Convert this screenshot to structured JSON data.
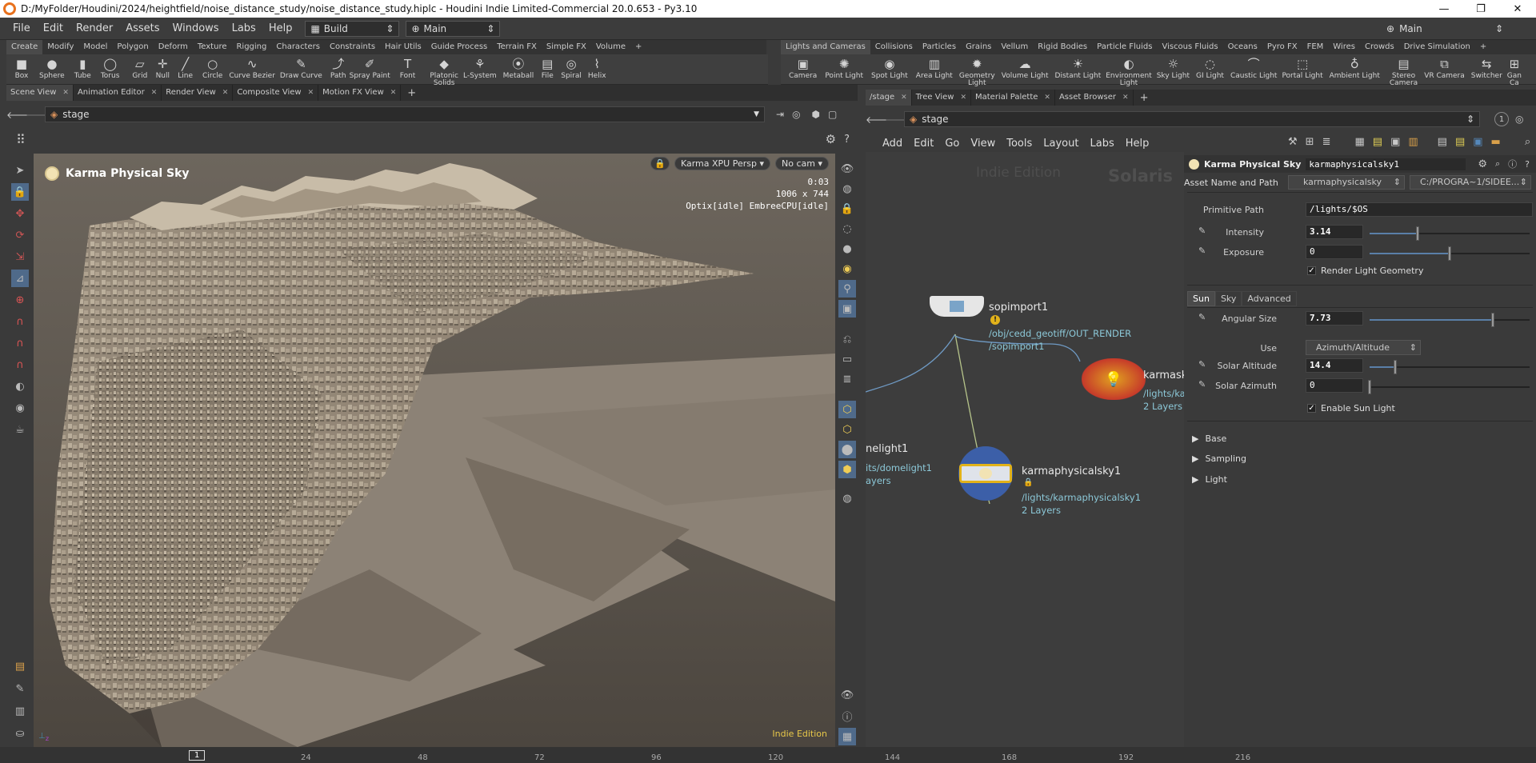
{
  "window": {
    "title": "D:/MyFolder/Houdini/2024/heightfield/noise_distance_study/noise_distance_study.hiplc - Houdini Indie Limited-Commercial 20.0.653 - Py3.10",
    "controls": [
      "—",
      "❐",
      "✕"
    ]
  },
  "menubar": {
    "items": [
      "File",
      "Edit",
      "Render",
      "Assets",
      "Windows",
      "Labs",
      "Help"
    ],
    "desktop": "Build",
    "network": "Main",
    "right_desktop": "Main"
  },
  "shelf_left": {
    "tabs": [
      "Create",
      "Modify",
      "Model",
      "Polygon",
      "Deform",
      "Texture",
      "Rigging",
      "Characters",
      "Constraints",
      "Hair Utils",
      "Guide Process",
      "Terrain FX",
      "Simple FX",
      "Volume",
      "+"
    ],
    "tools": [
      {
        "label": "Box",
        "icon": "box-icon",
        "glyph": "■"
      },
      {
        "label": "Sphere",
        "icon": "sphere-icon",
        "glyph": "●"
      },
      {
        "label": "Tube",
        "icon": "tube-icon",
        "glyph": "▮"
      },
      {
        "label": "Torus",
        "icon": "torus-icon",
        "glyph": "◯"
      },
      {
        "label": "Grid",
        "icon": "grid-icon",
        "glyph": "▱"
      },
      {
        "label": "Null",
        "icon": "null-icon",
        "glyph": "✛"
      },
      {
        "label": "Line",
        "icon": "line-icon",
        "glyph": "╱"
      },
      {
        "label": "Circle",
        "icon": "circle-icon",
        "glyph": "○"
      },
      {
        "label": "Curve Bezier",
        "icon": "curve-bezier-icon",
        "glyph": "∿"
      },
      {
        "label": "Draw Curve",
        "icon": "draw-curve-icon",
        "glyph": "✎"
      },
      {
        "label": "Path",
        "icon": "path-icon",
        "glyph": "⤴"
      },
      {
        "label": "Spray Paint",
        "icon": "spray-paint-icon",
        "glyph": "✐"
      },
      {
        "label": "Font",
        "icon": "font-icon",
        "glyph": "T"
      },
      {
        "label": "Platonic\nSolids",
        "icon": "platonic-icon",
        "glyph": "◆"
      },
      {
        "label": "L-System",
        "icon": "lsystem-icon",
        "glyph": "⚘"
      },
      {
        "label": "Metaball",
        "icon": "metaball-icon",
        "glyph": "⦿"
      },
      {
        "label": "File",
        "icon": "file-icon",
        "glyph": "▤"
      },
      {
        "label": "Spiral",
        "icon": "spiral-icon",
        "glyph": "◎"
      },
      {
        "label": "Helix",
        "icon": "helix-icon",
        "glyph": "⌇"
      }
    ]
  },
  "shelf_right": {
    "tabs": [
      "Lights and Cameras",
      "Collisions",
      "Particles",
      "Grains",
      "Vellum",
      "Rigid Bodies",
      "Particle Fluids",
      "Viscous Fluids",
      "Oceans",
      "Pyro FX",
      "FEM",
      "Wires",
      "Crowds",
      "Drive Simulation",
      "+"
    ],
    "tools": [
      {
        "label": "Camera",
        "icon": "camera-icon",
        "glyph": "▣"
      },
      {
        "label": "Point Light",
        "icon": "point-light-icon",
        "glyph": "✺"
      },
      {
        "label": "Spot Light",
        "icon": "spot-light-icon",
        "glyph": "◉"
      },
      {
        "label": "Area Light",
        "icon": "area-light-icon",
        "glyph": "▥"
      },
      {
        "label": "Geometry\nLight",
        "icon": "geometry-light-icon",
        "glyph": "✹"
      },
      {
        "label": "Volume Light",
        "icon": "volume-light-icon",
        "glyph": "☁"
      },
      {
        "label": "Distant Light",
        "icon": "distant-light-icon",
        "glyph": "☀"
      },
      {
        "label": "Environment\nLight",
        "icon": "environment-light-icon",
        "glyph": "◐"
      },
      {
        "label": "Sky Light",
        "icon": "sky-light-icon",
        "glyph": "☼"
      },
      {
        "label": "GI Light",
        "icon": "gi-light-icon",
        "glyph": "◌"
      },
      {
        "label": "Caustic Light",
        "icon": "caustic-light-icon",
        "glyph": "⌒"
      },
      {
        "label": "Portal Light",
        "icon": "portal-light-icon",
        "glyph": "⬚"
      },
      {
        "label": "Ambient Light",
        "icon": "ambient-light-icon",
        "glyph": "♁"
      },
      {
        "label": "Stereo\nCamera",
        "icon": "stereo-camera-icon",
        "glyph": "▤"
      },
      {
        "label": "VR Camera",
        "icon": "vr-camera-icon",
        "glyph": "⧉"
      },
      {
        "label": "Switcher",
        "icon": "switcher-icon",
        "glyph": "⇆"
      },
      {
        "label": "Gan\nCa",
        "icon": "gantry-camera-icon",
        "glyph": "⊞"
      }
    ]
  },
  "left_pane": {
    "tabs": [
      "Scene View",
      "Animation Editor",
      "Render View",
      "Composite View",
      "Motion FX View"
    ],
    "path": "stage",
    "viewport": {
      "title": "Karma Physical Sky",
      "renderer": "Karma XPU Persp",
      "camera": "No cam",
      "time": "0:03",
      "resolution": "1006 x 744",
      "status": "Optix[idle] EmbreeCPU[idle]",
      "watermark": "Indie Edition"
    }
  },
  "right_pane": {
    "tabs": [
      "/stage",
      "Tree View",
      "Material Palette",
      "Asset Browser"
    ],
    "path": "stage",
    "net_menu": [
      "Add",
      "Edit",
      "Go",
      "View",
      "Tools",
      "Layout",
      "Labs",
      "Help"
    ],
    "watermark_indie": "Indie Edition",
    "watermark_context": "Solaris",
    "nodes": {
      "sopimport": {
        "name": "sopimport1",
        "path1": "/obj/cedd_geotiff/OUT_RENDER",
        "path2": "/sopimport1"
      },
      "domelight": {
        "name": "nelight1",
        "path1": "its/domelight1",
        "path2": "ayers"
      },
      "karmasky_top": {
        "name": "karmask",
        "path1": "/lights/ka",
        "path2": "2 Layers"
      },
      "karmasky": {
        "name": "karmaphysicalsky1",
        "path1": "/lights/karmaphysicalsky1",
        "path2": "2 Layers"
      }
    }
  },
  "params": {
    "node_type": "Karma Physical Sky",
    "node_name": "karmaphysicalsky1",
    "asset_label": "Asset Name and Path",
    "asset_name": "karmaphysicalsky",
    "asset_path": "C:/PROGRA~1/SIDEE...",
    "primitive_path_label": "Primitive Path",
    "primitive_path": "/lights/$OS",
    "intensity_label": "Intensity",
    "intensity": "3.14",
    "intensity_fraction": 0.3,
    "exposure_label": "Exposure",
    "exposure": "0",
    "exposure_fraction": 0.5,
    "render_geo_label": "Render Light Geometry",
    "tabs": [
      "Sun",
      "Sky",
      "Advanced"
    ],
    "angular_size_label": "Angular Size",
    "angular_size": "7.73",
    "angular_size_fraction": 0.77,
    "use_label": "Use",
    "use_value": "Azimuth/Altitude",
    "solar_altitude_label": "Solar Altitude",
    "solar_altitude": "14.4",
    "solar_altitude_fraction": 0.16,
    "solar_azimuth_label": "Solar Azimuth",
    "solar_azimuth": "0",
    "solar_azimuth_fraction": 0.0,
    "enable_sun_label": "Enable Sun Light",
    "sections": [
      "Base",
      "Sampling",
      "Light"
    ]
  },
  "timeline": {
    "current": "1",
    "ticks": [
      "24",
      "48",
      "72",
      "96",
      "120",
      "144",
      "168",
      "192",
      "216"
    ]
  }
}
